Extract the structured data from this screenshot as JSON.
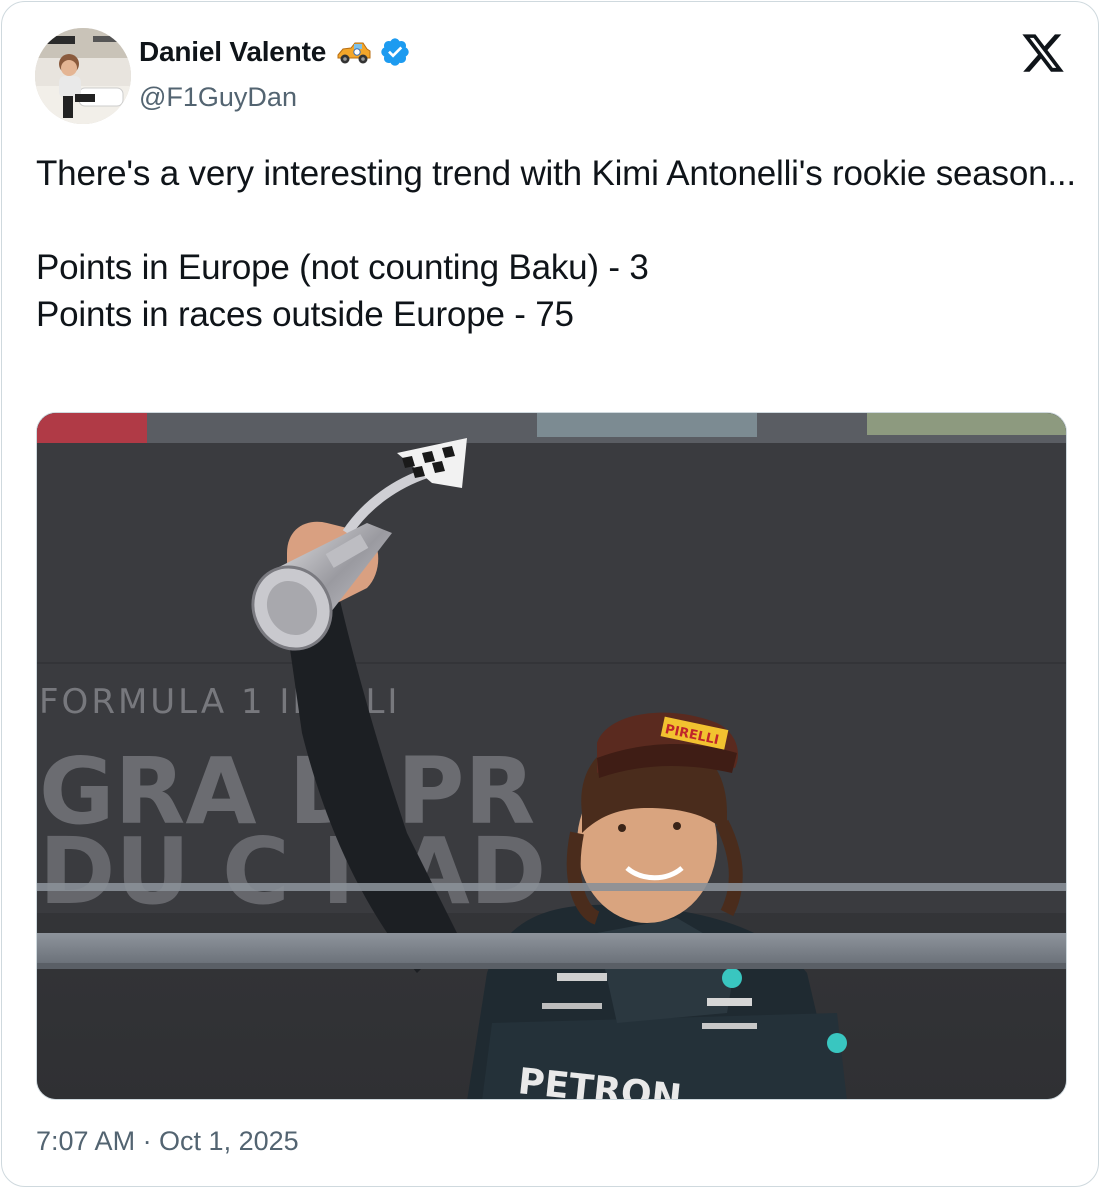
{
  "author": {
    "display_name": "Daniel Valente",
    "handle": "@F1GuyDan",
    "verified": true,
    "name_emoji": "racing-car-emoji"
  },
  "tweet": {
    "line1": "There's a very interesting trend with Kimi Antonelli's rookie season...",
    "line2": "Points in Europe (not counting Baku) - 3",
    "line3": "Points in races outside Europe - 75",
    "timestamp": "7:07 AM · Oct 1, 2025"
  },
  "media": {
    "backdrop_text_top": "FORMULA 1   IRELLI",
    "backdrop_text_line1": "GRA  D PR",
    "backdrop_text_line2": "DU C  NAD",
    "suit_text": "PETRON",
    "cap_text": "PIRELLI"
  },
  "colors": {
    "verified_blue": "#1d9bf0",
    "secondary_text": "#536471",
    "border": "#cfd9de"
  },
  "icons": {
    "platform_logo": "x-logo-icon",
    "verified_badge": "verified-badge-icon"
  }
}
